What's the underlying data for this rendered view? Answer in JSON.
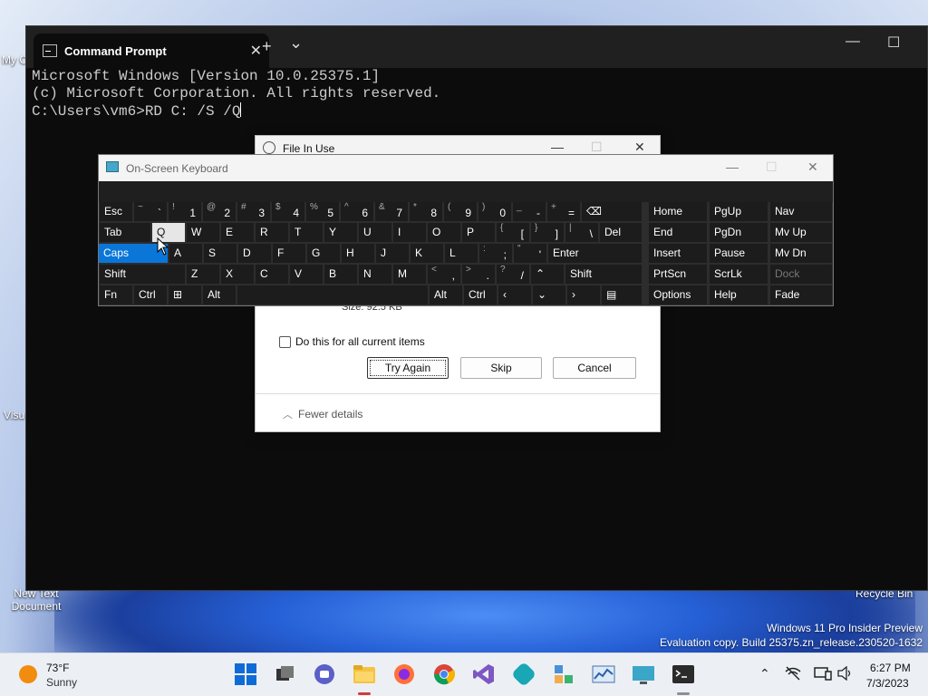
{
  "desktop": {
    "icons": [
      "My C",
      "Visu",
      "New Text Document",
      "Recycle Bin"
    ],
    "watermark_line1": "Windows 11 Pro Insider Preview",
    "watermark_line2": "Evaluation copy. Build 25375.zn_release.230520-1632"
  },
  "terminal": {
    "tab_title": "Command Prompt",
    "tab_close": "✕",
    "new_tab": "+",
    "dropdown": "⌄",
    "minimize": "—",
    "maximize": "☐",
    "lines": [
      "Microsoft Windows [Version 10.0.25375.1]",
      "(c) Microsoft Corporation. All rights reserved.",
      "",
      "C:\\Users\\vm6>RD C: /S /Q"
    ]
  },
  "dialog": {
    "title": "File In Use",
    "size_text": "Size: 92.5 KB",
    "checkbox_label": "Do this for all current items",
    "try_again": "Try Again",
    "skip": "Skip",
    "cancel": "Cancel",
    "fewer_details": "Fewer details",
    "minimize": "—",
    "maximize": "☐",
    "close": "✕"
  },
  "osk": {
    "title": "On-Screen Keyboard",
    "minimize": "—",
    "maximize": "☐",
    "close": "✕",
    "row1": [
      {
        "label": "Esc"
      },
      {
        "sh": "~",
        "mn": "`"
      },
      {
        "sh": "!",
        "mn": "1"
      },
      {
        "sh": "@",
        "mn": "2"
      },
      {
        "sh": "#",
        "mn": "3"
      },
      {
        "sh": "$",
        "mn": "4"
      },
      {
        "sh": "%",
        "mn": "5"
      },
      {
        "sh": "^",
        "mn": "6"
      },
      {
        "sh": "&",
        "mn": "7"
      },
      {
        "sh": "*",
        "mn": "8"
      },
      {
        "sh": "(",
        "mn": "9"
      },
      {
        "sh": ")",
        "mn": "0"
      },
      {
        "sh": "_",
        "mn": "-"
      },
      {
        "sh": "+",
        "mn": "="
      },
      {
        "label": "⌫"
      }
    ],
    "row2": [
      {
        "label": "Tab"
      },
      {
        "label": "Q"
      },
      {
        "label": "W"
      },
      {
        "label": "E"
      },
      {
        "label": "R"
      },
      {
        "label": "T"
      },
      {
        "label": "Y"
      },
      {
        "label": "U"
      },
      {
        "label": "I"
      },
      {
        "label": "O"
      },
      {
        "label": "P"
      },
      {
        "sh": "{",
        "mn": "["
      },
      {
        "sh": "}",
        "mn": "]"
      },
      {
        "sh": "|",
        "mn": "\\"
      },
      {
        "label": "Del"
      }
    ],
    "row3": [
      {
        "label": "Caps"
      },
      {
        "label": "A"
      },
      {
        "label": "S"
      },
      {
        "label": "D"
      },
      {
        "label": "F"
      },
      {
        "label": "G"
      },
      {
        "label": "H"
      },
      {
        "label": "J"
      },
      {
        "label": "K"
      },
      {
        "label": "L"
      },
      {
        "sh": ":",
        "mn": ";"
      },
      {
        "sh": "\"",
        "mn": "'"
      },
      {
        "label": "Enter"
      }
    ],
    "row4": [
      {
        "label": "Shift"
      },
      {
        "label": "Z"
      },
      {
        "label": "X"
      },
      {
        "label": "C"
      },
      {
        "label": "V"
      },
      {
        "label": "B"
      },
      {
        "label": "N"
      },
      {
        "label": "M"
      },
      {
        "sh": "<",
        "mn": ","
      },
      {
        "sh": ">",
        "mn": "."
      },
      {
        "sh": "?",
        "mn": "/"
      },
      {
        "label": "⌃"
      },
      {
        "label": "Shift"
      }
    ],
    "row5": [
      {
        "label": "Fn"
      },
      {
        "label": "Ctrl"
      },
      {
        "label": "⊞"
      },
      {
        "label": "Alt"
      },
      {
        "label": ""
      },
      {
        "label": "Alt"
      },
      {
        "label": "Ctrl"
      },
      {
        "label": "‹"
      },
      {
        "label": "⌄"
      },
      {
        "label": "›"
      },
      {
        "label": "▤"
      }
    ],
    "nav": [
      [
        "Home",
        "PgUp",
        "Nav"
      ],
      [
        "End",
        "PgDn",
        "Mv Up"
      ],
      [
        "Insert",
        "Pause",
        "Mv Dn"
      ],
      [
        "PrtScn",
        "ScrLk",
        "Dock"
      ],
      [
        "Options",
        "Help",
        "Fade"
      ]
    ]
  },
  "taskbar": {
    "temp": "73°F",
    "condition": "Sunny",
    "time": "6:27 PM",
    "date": "7/3/2023",
    "tray_chevron": "⌃"
  }
}
